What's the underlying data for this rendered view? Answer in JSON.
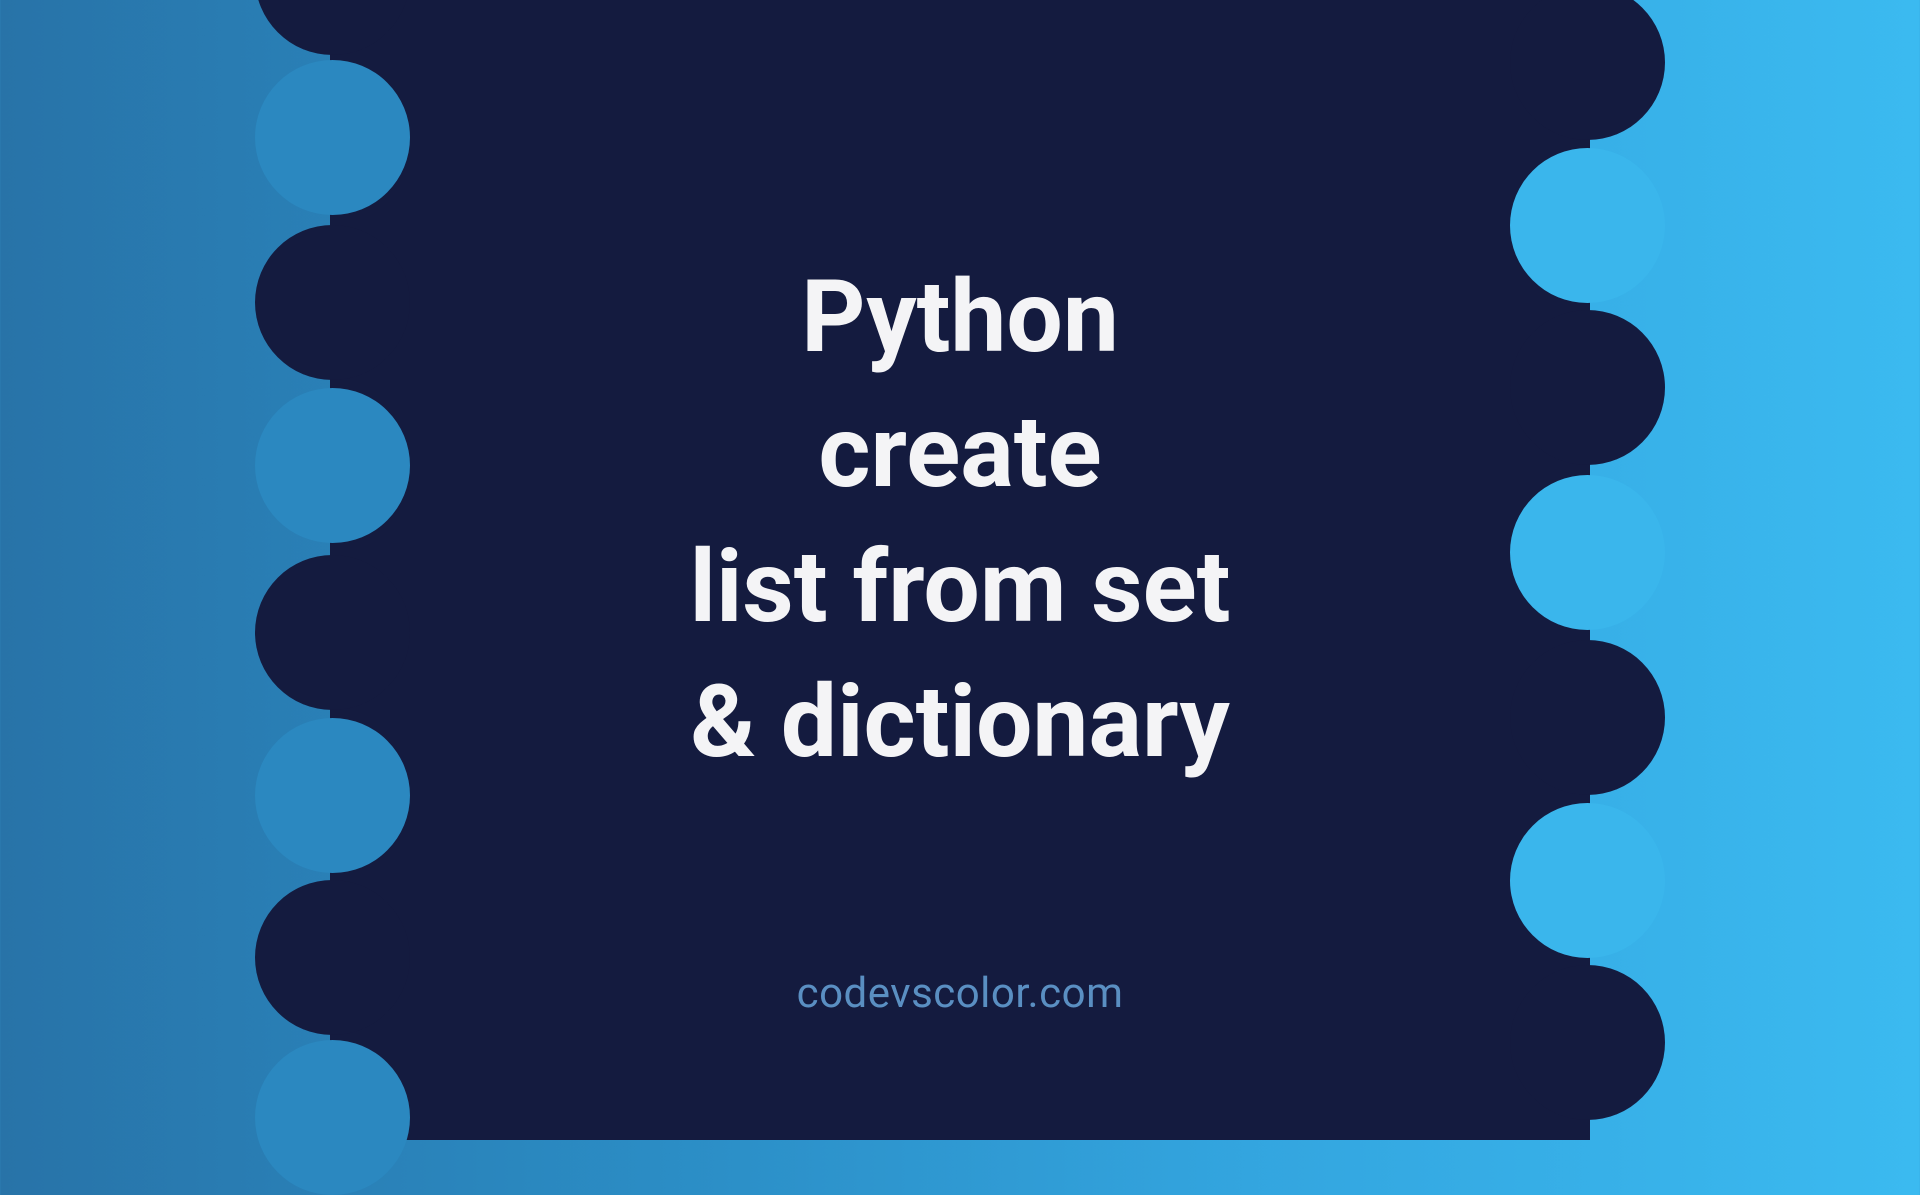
{
  "title": {
    "line1": "Python",
    "line2": "create",
    "line3": "list from set",
    "line4": "& dictionary"
  },
  "footer": "codevscolor.com",
  "colors": {
    "blob": "#141b3f",
    "text": "#f4f4f6",
    "footer": "#5a8fc2",
    "gradient_start": "#2873a8",
    "gradient_end": "#3bbaf0"
  }
}
